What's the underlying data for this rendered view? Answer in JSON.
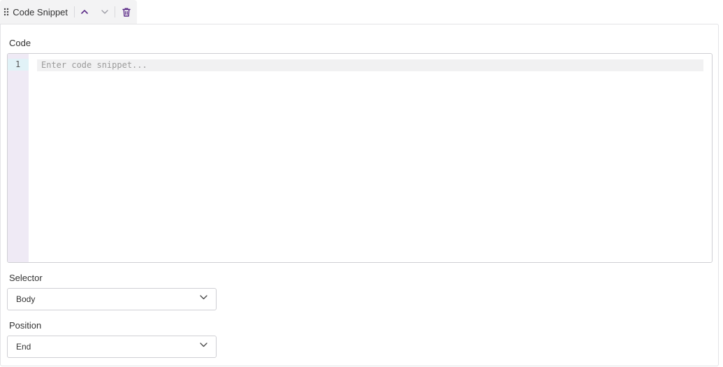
{
  "block": {
    "title": "Code Snippet",
    "icons": {
      "drag": "drag-handle-icon",
      "move_up": "chevron-up-icon",
      "move_down": "chevron-down-icon",
      "delete": "trash-icon"
    },
    "accent_color": "#5b2b87"
  },
  "code": {
    "label": "Code",
    "line_number": "1",
    "placeholder": "Enter code snippet...",
    "value": ""
  },
  "selector": {
    "label": "Selector",
    "selected": "Body"
  },
  "position": {
    "label": "Position",
    "selected": "End"
  }
}
